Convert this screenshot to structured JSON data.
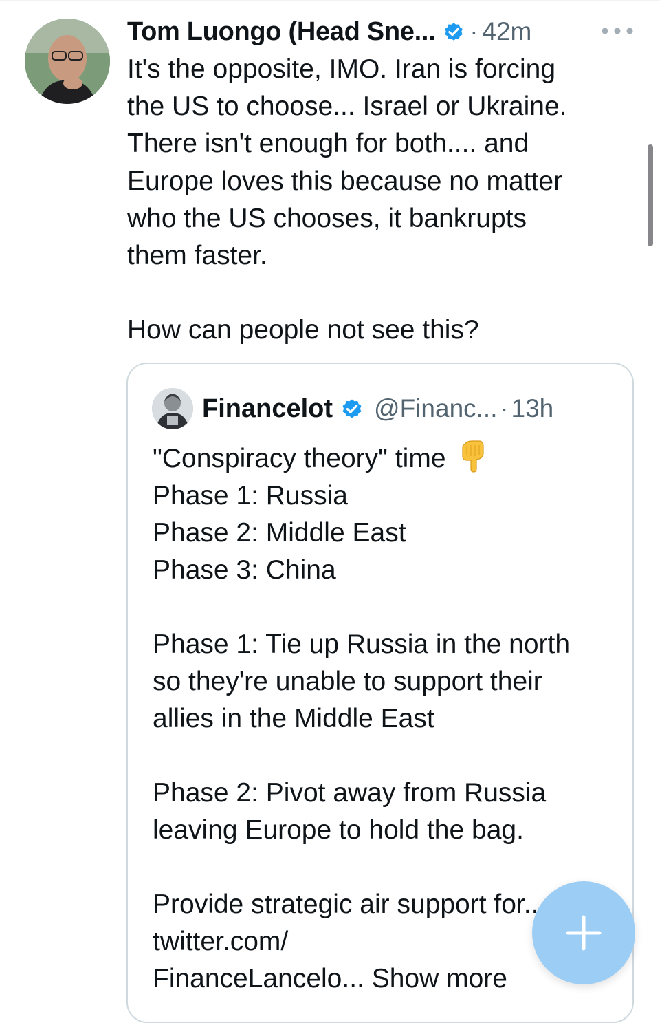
{
  "tweet": {
    "author_name": "Tom Luongo (Head Sne...",
    "separator": "·",
    "time": "42m",
    "text": "It's the opposite, IMO. Iran is forcing\nthe US to choose... Israel or Ukraine.\nThere isn't enough for both.... and\nEurope loves this because no matter\nwho the US chooses, it bankrupts\nthem faster.\n\nHow can people not see this?",
    "avatar_icon": "profile-photo",
    "verified_icon": "verified-badge-icon",
    "more_icon": "more-options-icon"
  },
  "quote": {
    "author_name": "Financelot",
    "handle": "@Financ...",
    "separator": "·",
    "time": "13h",
    "first_line": "\"Conspiracy theory\" time",
    "emoji": "backhand-index-pointing-down",
    "text": "Phase 1: Russia\nPhase 2: Middle East\nPhase 3: China\n\nPhase 1: Tie up Russia in the north\nso they're unable to support their\nallies in the Middle East\n\nPhase 2: Pivot away from Russia\nleaving Europe to hold the bag.\n\nProvide strategic air support for...\ntwitter.com/\nFinanceLancelo... ",
    "show_more": "Show more"
  },
  "compose_button": {
    "icon": "plus-icon"
  },
  "colors": {
    "text": "#0f1419",
    "secondary": "#536471",
    "verified": "#1d9bf0",
    "fab": "#9bcdf5",
    "border": "#cfd9de"
  }
}
